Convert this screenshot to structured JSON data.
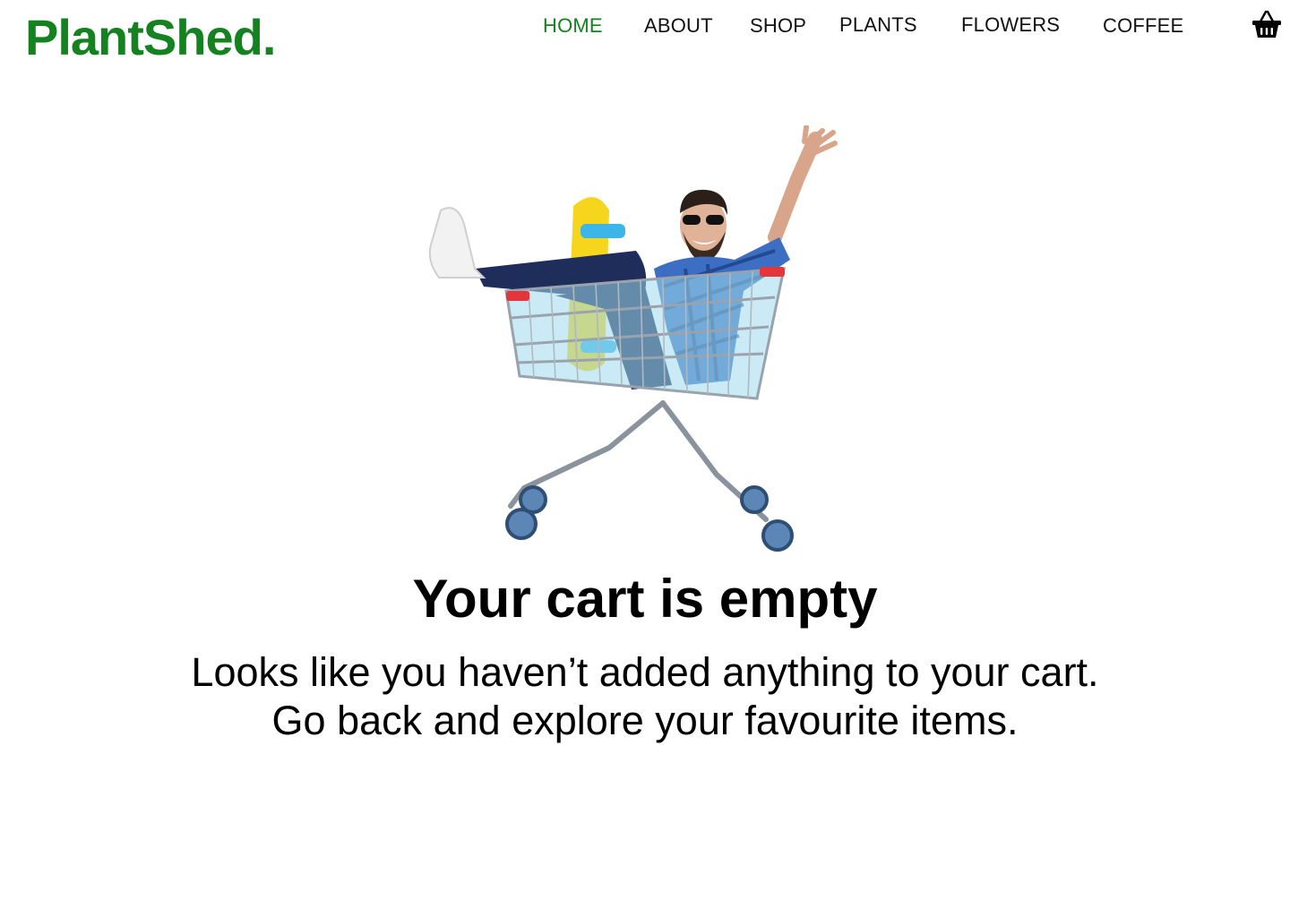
{
  "brand": {
    "name": "PlantShed.",
    "color": "#13821f"
  },
  "nav": {
    "items": [
      {
        "label": "HOME",
        "active": true
      },
      {
        "label": "ABOUT",
        "active": false
      },
      {
        "label": "SHOP",
        "active": false
      },
      {
        "label": "PLANTS",
        "active": false
      },
      {
        "label": "FLOWERS",
        "active": false
      },
      {
        "label": "COFFEE",
        "active": false
      }
    ],
    "cart_icon": "basket-icon"
  },
  "main": {
    "illustration": "man-in-shopping-cart-image",
    "title": "Your cart is empty",
    "message_line1": "Looks like you haven’t added anything to your cart.",
    "message_line2": "Go back and explore your favourite items."
  }
}
